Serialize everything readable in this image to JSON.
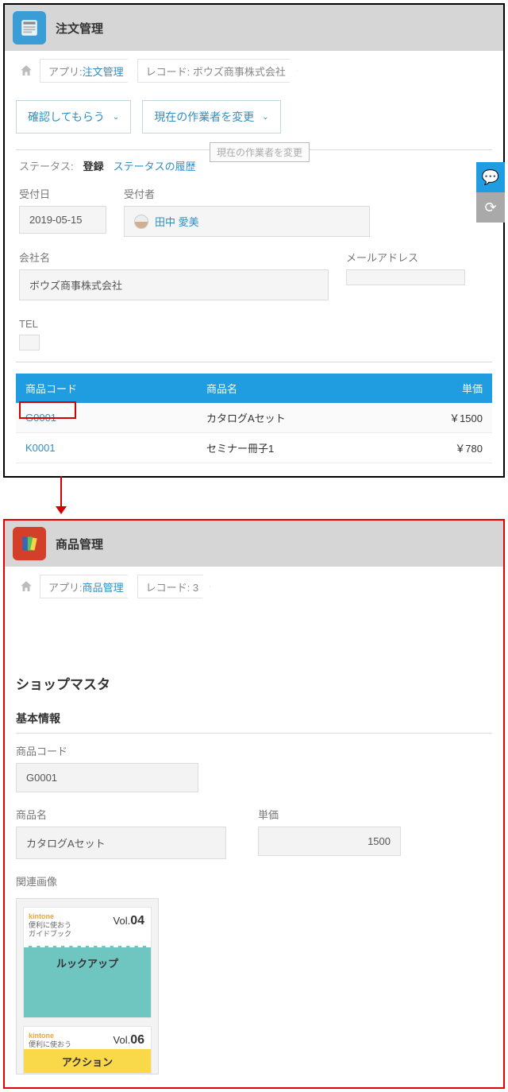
{
  "panel1": {
    "title": "注文管理",
    "breadcrumb": {
      "app_prefix": "アプリ: ",
      "app_link": "注文管理",
      "record": "レコード: ボウズ商事株式会社"
    },
    "buttons": {
      "confirm": "確認してもらう",
      "change_assignee": "現在の作業者を変更"
    },
    "tooltip": "現在の作業者を変更",
    "status": {
      "label": "ステータス: ",
      "value": "登録",
      "history_link": "ステータスの履歴"
    },
    "fields": {
      "recv_date_label": "受付日",
      "recv_date_value": "2019-05-15",
      "recv_person_label": "受付者",
      "recv_person_value": "田中 愛美",
      "company_label": "会社名",
      "company_value": "ボウズ商事株式会社",
      "email_label": "メールアドレス",
      "tel_label": "TEL"
    },
    "table": {
      "col_code": "商品コード",
      "col_name": "商品名",
      "col_price": "単価",
      "rows": [
        {
          "code": "G0001",
          "name": "カタログAセット",
          "price": "￥1500"
        },
        {
          "code": "K0001",
          "name": "セミナー冊子1",
          "price": "￥780"
        }
      ]
    }
  },
  "panel2": {
    "title": "商品管理",
    "breadcrumb": {
      "app_prefix": "アプリ: ",
      "app_link": "商品管理",
      "record": "レコード: 3"
    },
    "section_title": "ショップマスタ",
    "sub_title": "基本情報",
    "fields": {
      "code_label": "商品コード",
      "code_value": "G0001",
      "name_label": "商品名",
      "name_value": "カタログAセット",
      "price_label": "単価",
      "price_value": "1500",
      "images_label": "関連画像"
    },
    "books": {
      "brand": "kintone",
      "line1": "便利に使おう",
      "line2": "ガイドブック",
      "vol04": "04",
      "vol06": "06",
      "title04": "ルックアップ",
      "title06": "アクション"
    }
  }
}
